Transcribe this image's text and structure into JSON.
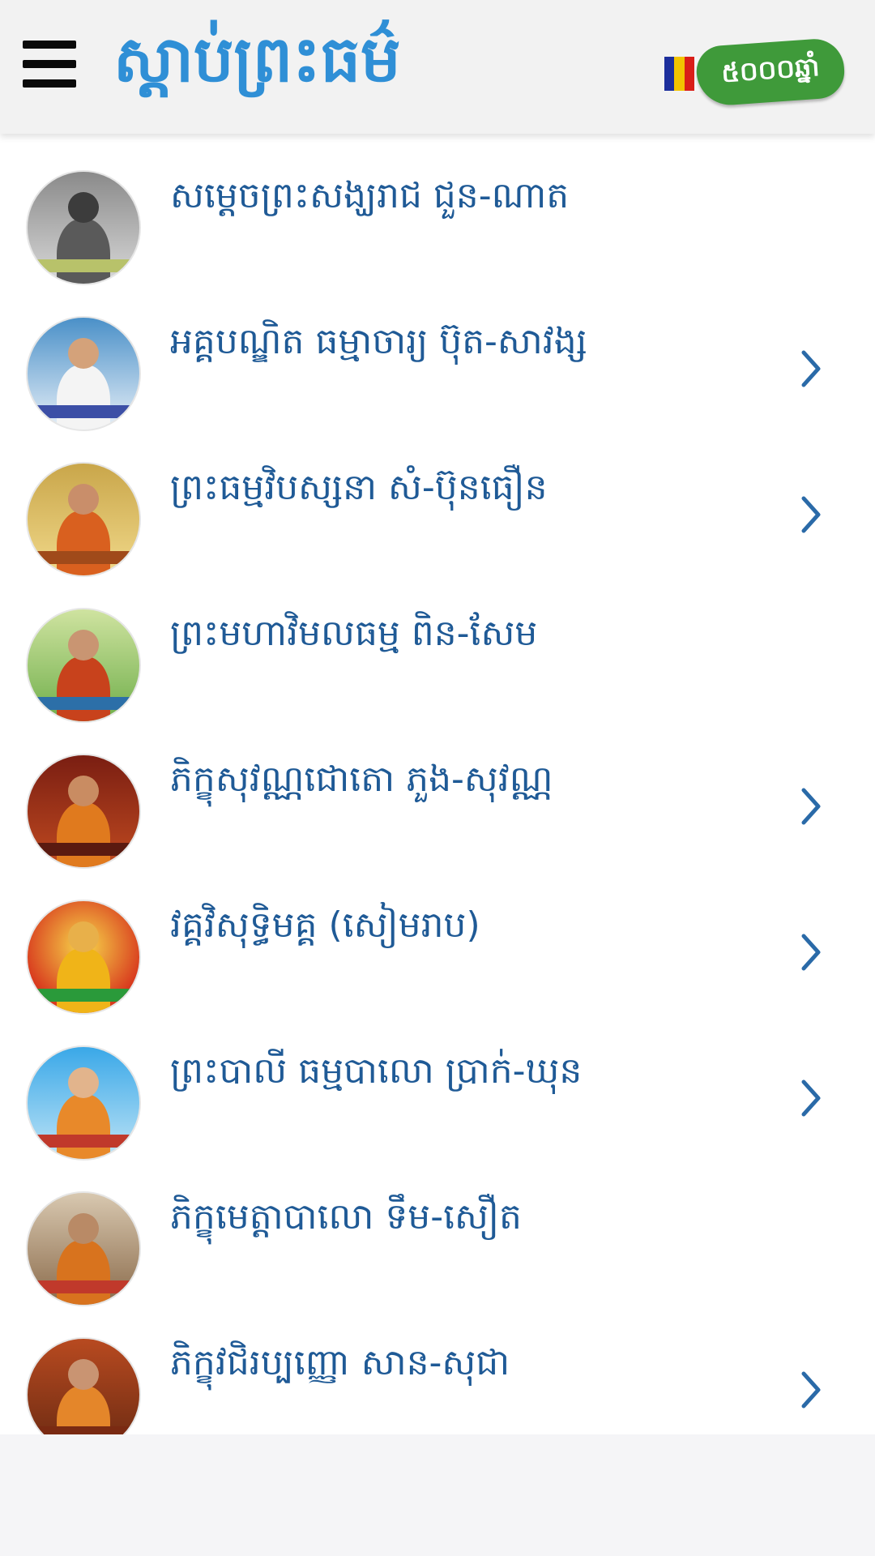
{
  "header": {
    "app_title": "ស្ដាប់ព្រះធម៌",
    "menu_icon": "hamburger-menu-icon",
    "badge_text": "៥០០០ឆ្នាំ",
    "flag_colors": [
      "#1d2f9c",
      "#f2c400",
      "#d91e18",
      "#f5f5f5",
      "#f08a24"
    ],
    "badge_color": "#3f9a3a"
  },
  "colors": {
    "accent": "#2f8fd6",
    "item_text": "#1f5a96",
    "chevron": "#2a6aa8"
  },
  "list": {
    "items": [
      {
        "label": "សម្ដេចព្រះសង្ឃរាជ ជួន-ណាត",
        "has_chevron": false
      },
      {
        "label": "អគ្គបណ្ឌិត ធម្មាចារ្យ ប៊ុត-សាវង្ស",
        "has_chevron": true
      },
      {
        "label": "ព្រះធម្មវិបស្សនា សំ-ប៊ុនធឿន",
        "has_chevron": true
      },
      {
        "label": "ព្រះមហាវិមលធម្ម ពិន-សែម",
        "has_chevron": false
      },
      {
        "label": "ភិក្ខុសុវណ្ណជោតោ ភួង-សុវណ្ណ",
        "has_chevron": true
      },
      {
        "label": "វគ្គវិសុទ្ធិមគ្គ (សៀមរាប)",
        "has_chevron": true
      },
      {
        "label": "ព្រះបាលី ធម្មបាលោ ប្រាក់-ឃុន",
        "has_chevron": true
      },
      {
        "label": "ភិក្ខុមេត្តាបាលោ ទឹម-សឿត",
        "has_chevron": false
      },
      {
        "label": "ភិក្ខុវជិរប្បញ្ញោ សាន-សុជា",
        "has_chevron": true
      }
    ]
  }
}
